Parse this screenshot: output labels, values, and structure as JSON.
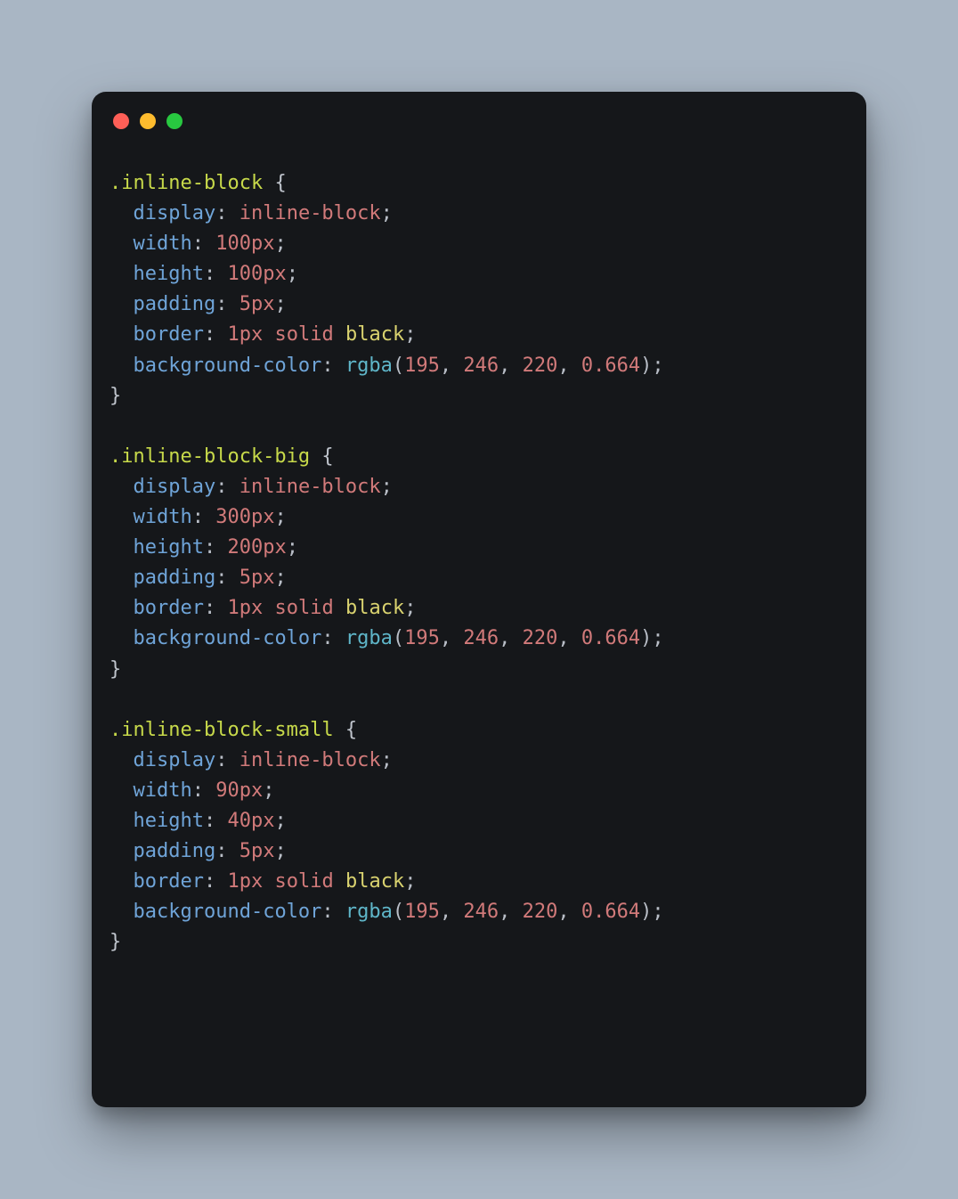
{
  "traffic_lights": {
    "close": "close-icon",
    "minimize": "minimize-icon",
    "zoom": "zoom-icon"
  },
  "css_rules": [
    {
      "selector": ".inline-block",
      "declarations": [
        {
          "property": "display",
          "value_tokens": [
            {
              "t": "kw",
              "v": "inline-block"
            }
          ]
        },
        {
          "property": "width",
          "value_tokens": [
            {
              "t": "num",
              "v": "100px"
            }
          ]
        },
        {
          "property": "height",
          "value_tokens": [
            {
              "t": "num",
              "v": "100px"
            }
          ]
        },
        {
          "property": "padding",
          "value_tokens": [
            {
              "t": "num",
              "v": "5px"
            }
          ]
        },
        {
          "property": "border",
          "value_tokens": [
            {
              "t": "num",
              "v": "1px"
            },
            {
              "t": "sp",
              "v": " "
            },
            {
              "t": "kw",
              "v": "solid"
            },
            {
              "t": "sp",
              "v": " "
            },
            {
              "t": "ident",
              "v": "black"
            }
          ]
        },
        {
          "property": "background-color",
          "value_tokens": [
            {
              "t": "func",
              "v": "rgba"
            },
            {
              "t": "punc",
              "v": "("
            },
            {
              "t": "num",
              "v": "195"
            },
            {
              "t": "punc",
              "v": ", "
            },
            {
              "t": "num",
              "v": "246"
            },
            {
              "t": "punc",
              "v": ", "
            },
            {
              "t": "num",
              "v": "220"
            },
            {
              "t": "punc",
              "v": ", "
            },
            {
              "t": "num",
              "v": "0.664"
            },
            {
              "t": "punc",
              "v": ")"
            }
          ]
        }
      ]
    },
    {
      "selector": ".inline-block-big",
      "declarations": [
        {
          "property": "display",
          "value_tokens": [
            {
              "t": "kw",
              "v": "inline-block"
            }
          ]
        },
        {
          "property": "width",
          "value_tokens": [
            {
              "t": "num",
              "v": "300px"
            }
          ]
        },
        {
          "property": "height",
          "value_tokens": [
            {
              "t": "num",
              "v": "200px"
            }
          ]
        },
        {
          "property": "padding",
          "value_tokens": [
            {
              "t": "num",
              "v": "5px"
            }
          ]
        },
        {
          "property": "border",
          "value_tokens": [
            {
              "t": "num",
              "v": "1px"
            },
            {
              "t": "sp",
              "v": " "
            },
            {
              "t": "kw",
              "v": "solid"
            },
            {
              "t": "sp",
              "v": " "
            },
            {
              "t": "ident",
              "v": "black"
            }
          ]
        },
        {
          "property": "background-color",
          "value_tokens": [
            {
              "t": "func",
              "v": "rgba"
            },
            {
              "t": "punc",
              "v": "("
            },
            {
              "t": "num",
              "v": "195"
            },
            {
              "t": "punc",
              "v": ", "
            },
            {
              "t": "num",
              "v": "246"
            },
            {
              "t": "punc",
              "v": ", "
            },
            {
              "t": "num",
              "v": "220"
            },
            {
              "t": "punc",
              "v": ", "
            },
            {
              "t": "num",
              "v": "0.664"
            },
            {
              "t": "punc",
              "v": ")"
            }
          ]
        }
      ]
    },
    {
      "selector": ".inline-block-small",
      "declarations": [
        {
          "property": "display",
          "value_tokens": [
            {
              "t": "kw",
              "v": "inline-block"
            }
          ]
        },
        {
          "property": "width",
          "value_tokens": [
            {
              "t": "num",
              "v": "90px"
            }
          ]
        },
        {
          "property": "height",
          "value_tokens": [
            {
              "t": "num",
              "v": "40px"
            }
          ]
        },
        {
          "property": "padding",
          "value_tokens": [
            {
              "t": "num",
              "v": "5px"
            }
          ]
        },
        {
          "property": "border",
          "value_tokens": [
            {
              "t": "num",
              "v": "1px"
            },
            {
              "t": "sp",
              "v": " "
            },
            {
              "t": "kw",
              "v": "solid"
            },
            {
              "t": "sp",
              "v": " "
            },
            {
              "t": "ident",
              "v": "black"
            }
          ]
        },
        {
          "property": "background-color",
          "value_tokens": [
            {
              "t": "func",
              "v": "rgba"
            },
            {
              "t": "punc",
              "v": "("
            },
            {
              "t": "num",
              "v": "195"
            },
            {
              "t": "punc",
              "v": ", "
            },
            {
              "t": "num",
              "v": "246"
            },
            {
              "t": "punc",
              "v": ", "
            },
            {
              "t": "num",
              "v": "220"
            },
            {
              "t": "punc",
              "v": ", "
            },
            {
              "t": "num",
              "v": "0.664"
            },
            {
              "t": "punc",
              "v": ")"
            }
          ]
        }
      ]
    }
  ]
}
